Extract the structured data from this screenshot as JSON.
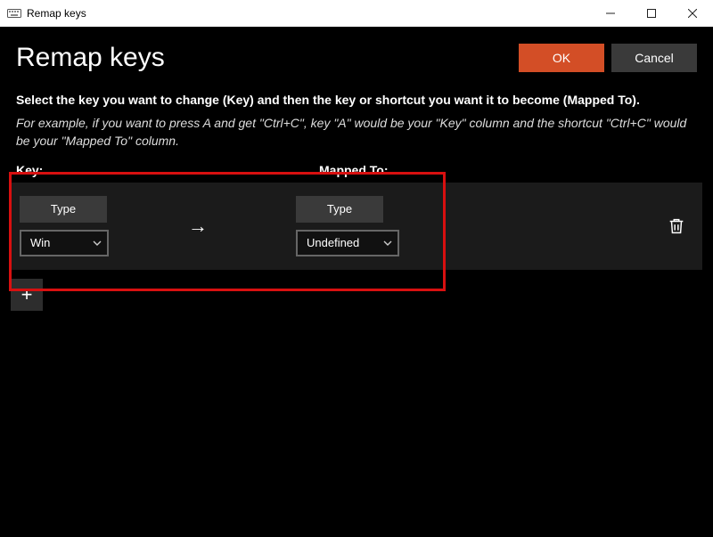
{
  "window": {
    "title": "Remap keys"
  },
  "header": {
    "title": "Remap keys",
    "ok_label": "OK",
    "cancel_label": "Cancel"
  },
  "instructions": "Select the key you want to change (Key) and then the key or shortcut you want it to become (Mapped To).",
  "example": "For example, if you want to press A and get \"Ctrl+C\", key \"A\" would be your \"Key\" column and the shortcut \"Ctrl+C\" would be your \"Mapped To\" column.",
  "labels": {
    "key": "Key:",
    "mapped": "Mapped To:"
  },
  "row": {
    "type_label": "Type",
    "key_value": "Win",
    "mapped_value": "Undefined"
  },
  "icons": {
    "arrow": "→",
    "plus": "+"
  },
  "colors": {
    "accent": "#d34e26",
    "highlight": "#d81010"
  }
}
